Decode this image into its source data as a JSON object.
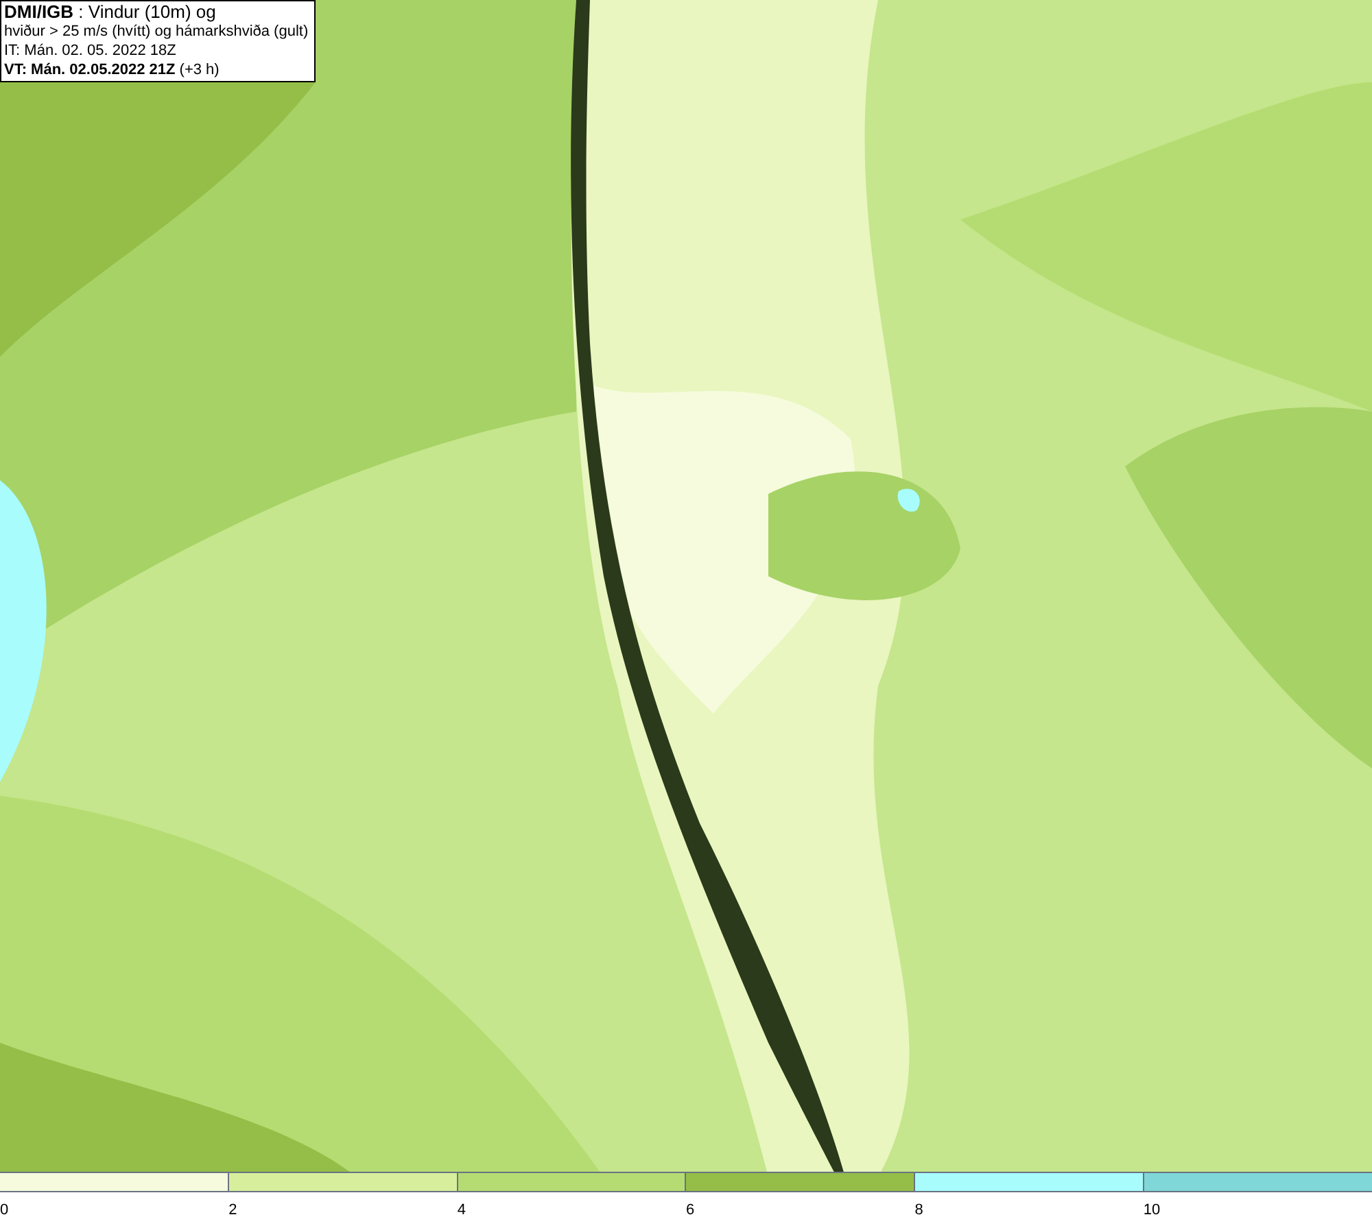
{
  "header": {
    "lines": [
      "**DMI/IGB** : Vindur (10m) og",
      "hviður > 25 m/s (hvítt) og hámarkshviða (gult)",
      "IT: Mán. 02. 05. 2022 18Z",
      "**VT: Mán. 02.05.2022 21Z** (+3 h)"
    ]
  },
  "legend": {
    "bins": [
      {
        "label": "0",
        "color": "#f5fbdc"
      },
      {
        "label": "2",
        "color": "#d7ee9c"
      },
      {
        "label": "4",
        "color": "#b5dc72"
      },
      {
        "label": "6",
        "color": "#94be48"
      },
      {
        "label": "8",
        "color": "#a8fcfc"
      },
      {
        "label": "10",
        "color": "#7fd7d7"
      }
    ]
  }
}
